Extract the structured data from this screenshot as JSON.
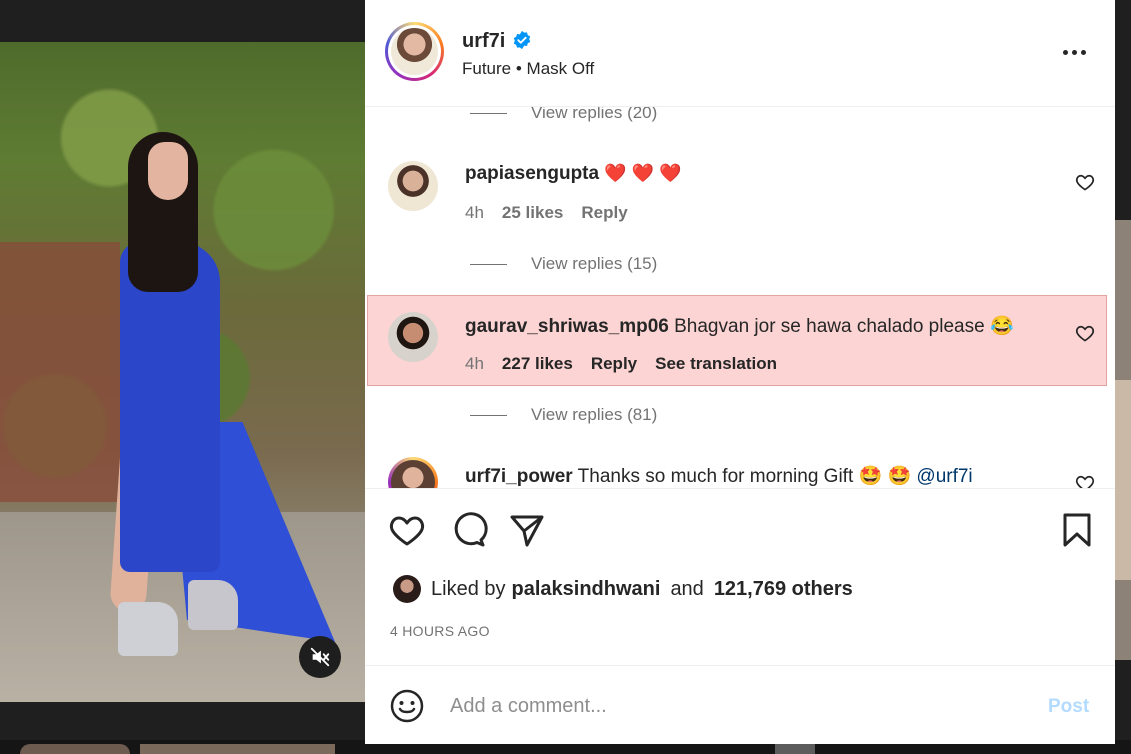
{
  "post": {
    "username": "urf7i",
    "audio": "Future • Mask Off",
    "verified_icon": "verified-badge-icon",
    "more_icon": "more-horizontal-icon"
  },
  "comments": {
    "replies_top": "View replies (20)",
    "c1": {
      "user": "papiasengupta",
      "text": "❤️ ❤️ ❤️",
      "time": "4h",
      "likes": "25 likes",
      "reply": "Reply",
      "replies": "View replies (15)"
    },
    "c2": {
      "user": "gaurav_shriwas_mp06",
      "text": "Bhagvan jor se hawa chalado please 😂",
      "time": "4h",
      "likes": "227 likes",
      "reply": "Reply",
      "translate": "See translation",
      "replies": "View replies (81)",
      "highlight_color": "#fdd4d4"
    },
    "c3": {
      "user": "urf7i_power",
      "text": "Thanks so much for morning Gift 🤩 🤩",
      "mention": "@urf7i"
    }
  },
  "footer": {
    "liked_by_prefix": "Liked by",
    "liked_by_user": "palaksindhwani",
    "and": "and",
    "others": "121,769 others",
    "time_ago": "4 HOURS AGO",
    "comment_placeholder": "Add a comment...",
    "post_label": "Post"
  },
  "colors": {
    "accent_blue": "#0095f6",
    "post_disabled": "#b3dbff",
    "text": "#262626",
    "muted": "#737373"
  }
}
